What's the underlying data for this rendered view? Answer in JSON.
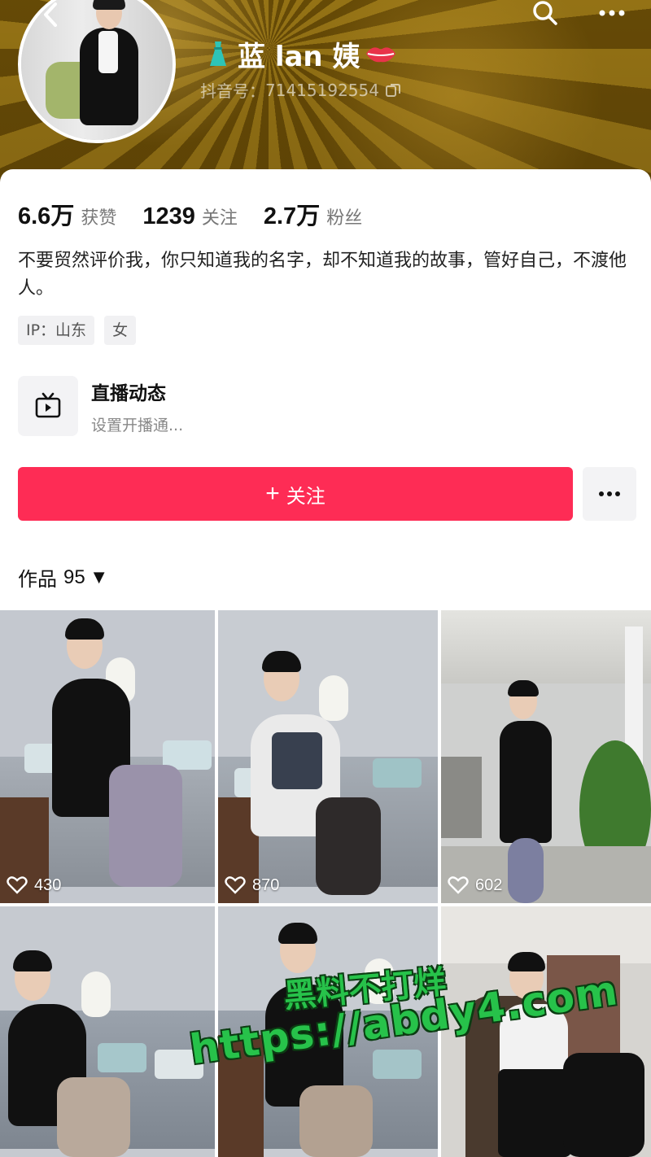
{
  "header": {
    "back_icon": "chevron-left-icon",
    "search_icon": "search-icon",
    "more_icon": "ellipsis-icon",
    "banner_color": "#8a6510"
  },
  "profile": {
    "name": "蓝 lan 姨",
    "name_prefix_icon": "dress-icon",
    "name_suffix_icon": "lips-icon",
    "id_label": "抖音号：",
    "id_value": "71415192554",
    "copy_icon": "copy-icon"
  },
  "stats": [
    {
      "value": "6.6万",
      "label": "获赞"
    },
    {
      "value": "1239",
      "label": "关注"
    },
    {
      "value": "2.7万",
      "label": "粉丝"
    }
  ],
  "bio": "不要贸然评价我，你只知道我的名字，却不知道我的故事，管好自己，不渡他人。",
  "tags": [
    "IP：山东",
    "女"
  ],
  "live": {
    "icon": "live-tv-icon",
    "title": "直播动态",
    "subtitle": "设置开播通..."
  },
  "actions": {
    "follow_label": "关注",
    "follow_plus": "+",
    "follow_color": "#fe2c55",
    "more_icon": "ellipsis-icon"
  },
  "works": {
    "label": "作品",
    "count": "95",
    "caret": "▼",
    "items": [
      {
        "likes": "430"
      },
      {
        "likes": "870"
      },
      {
        "likes": "602"
      },
      {
        "likes": ""
      },
      {
        "likes": ""
      },
      {
        "likes": ""
      }
    ]
  },
  "watermark": {
    "line1": "黑料不打烊",
    "line2": "https://abdy4.com",
    "color": "#27c24a"
  }
}
